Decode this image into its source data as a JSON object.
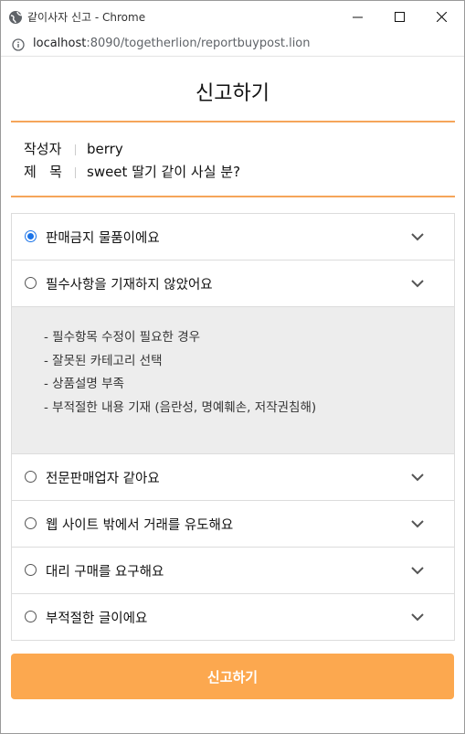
{
  "window": {
    "title": "같이사자 신고 - Chrome",
    "url_host": "localhost",
    "url_path": ":8090/togetherlion/reportbuypost.lion"
  },
  "page": {
    "heading": "신고하기",
    "writer_label": "작성자",
    "writer_value": "berry",
    "title_label": "제   목",
    "title_value": "sweet 딸기 같이 사실 분?"
  },
  "reasons": [
    {
      "label": "판매금지 물품이에요",
      "checked": true
    },
    {
      "label": "필수사항을 기재하지 않았어요",
      "checked": false
    }
  ],
  "details": [
    "- 필수항목 수정이 필요한 경우",
    "- 잘못된 카테고리 선택",
    "- 상품설명 부족",
    "- 부적절한 내용 기재 (음란성, 명예훼손, 저작권침해)"
  ],
  "reasons_more": [
    {
      "label": "전문판매업자 같아요",
      "checked": false
    },
    {
      "label": "웹 사이트 밖에서 거래를 유도해요",
      "checked": false
    },
    {
      "label": "대리 구매를 요구해요",
      "checked": false
    },
    {
      "label": "부적절한 글이에요",
      "checked": false
    }
  ],
  "submit_label": "신고하기",
  "colors": {
    "accent": "#fca84f",
    "divider": "#f5a55a",
    "radio": "#1a73e8"
  }
}
